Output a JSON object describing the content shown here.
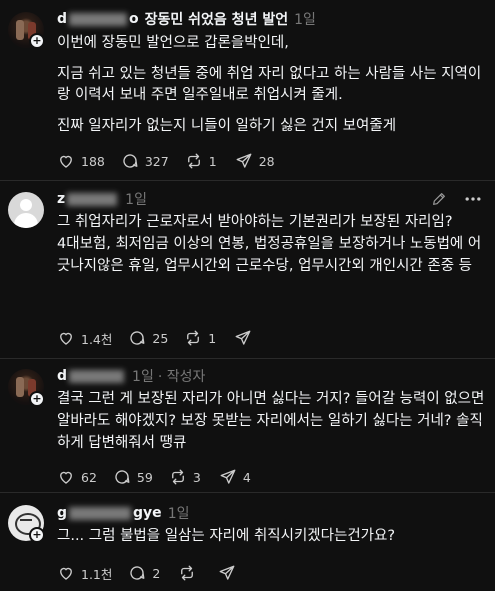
{
  "posts": [
    {
      "username_visible": "d",
      "username_suffix": "o",
      "title": "장동민 쉬었음 청년 발언",
      "time": "1일",
      "paragraphs": [
        "이번에 장동민 발언으로 갑론을박인데,",
        "지금 쉬고 있는 청년들 중에 취업 자리 없다고 하는 사람들 사는 지역이랑 이력서 보내 주면 일주일내로 취업시켜 줄게.",
        "진짜 일자리가 없는지 니들이 일하기 싫은 건지 보여줄게"
      ],
      "likes": "188",
      "comments": "327",
      "reposts": "1",
      "shares": "28"
    },
    {
      "username_visible": "z",
      "time": "1일",
      "text": "그 취업자리가 근로자로서 받아야하는 기본권리가 보장된 자리임?\n4대보험, 최저임금 이상의 연봉, 법정공휴일을 보장하거나 노동법에 어긋나지않은 휴일, 업무시간외 근로수당, 업무시간외 개인시간 존중 등",
      "likes": "1.4천",
      "comments": "25",
      "reposts": "1",
      "shares": ""
    },
    {
      "username_visible": "d",
      "time": "1일",
      "author_tag": "· 작성자",
      "text": "결국 그런 게 보장된 자리가 아니면 싫다는 거지? 들어갈 능력이 없으면 알바라도 해야겠지? 보장 못받는 자리에서는 일하기 싫다는 거네? 솔직하게 답변해줘서 땡큐",
      "likes": "62",
      "comments": "59",
      "reposts": "3",
      "shares": "4"
    },
    {
      "username_visible": "g",
      "username_suffix": "gye",
      "time": "1일",
      "text": "그... 그럼 불법을 일삼는 자리에 취직시키겠다는건가요?",
      "likes": "1.1천",
      "comments": "2",
      "reposts": "",
      "shares": ""
    }
  ],
  "colors": {
    "background": "#101010",
    "text": "#f3f5f7",
    "muted": "#777777",
    "divider": "#2a2a2a"
  },
  "icons": [
    "heart-icon",
    "comment-icon",
    "repost-icon",
    "share-icon",
    "plus-badge-icon",
    "pencil-icon",
    "more-icon"
  ]
}
